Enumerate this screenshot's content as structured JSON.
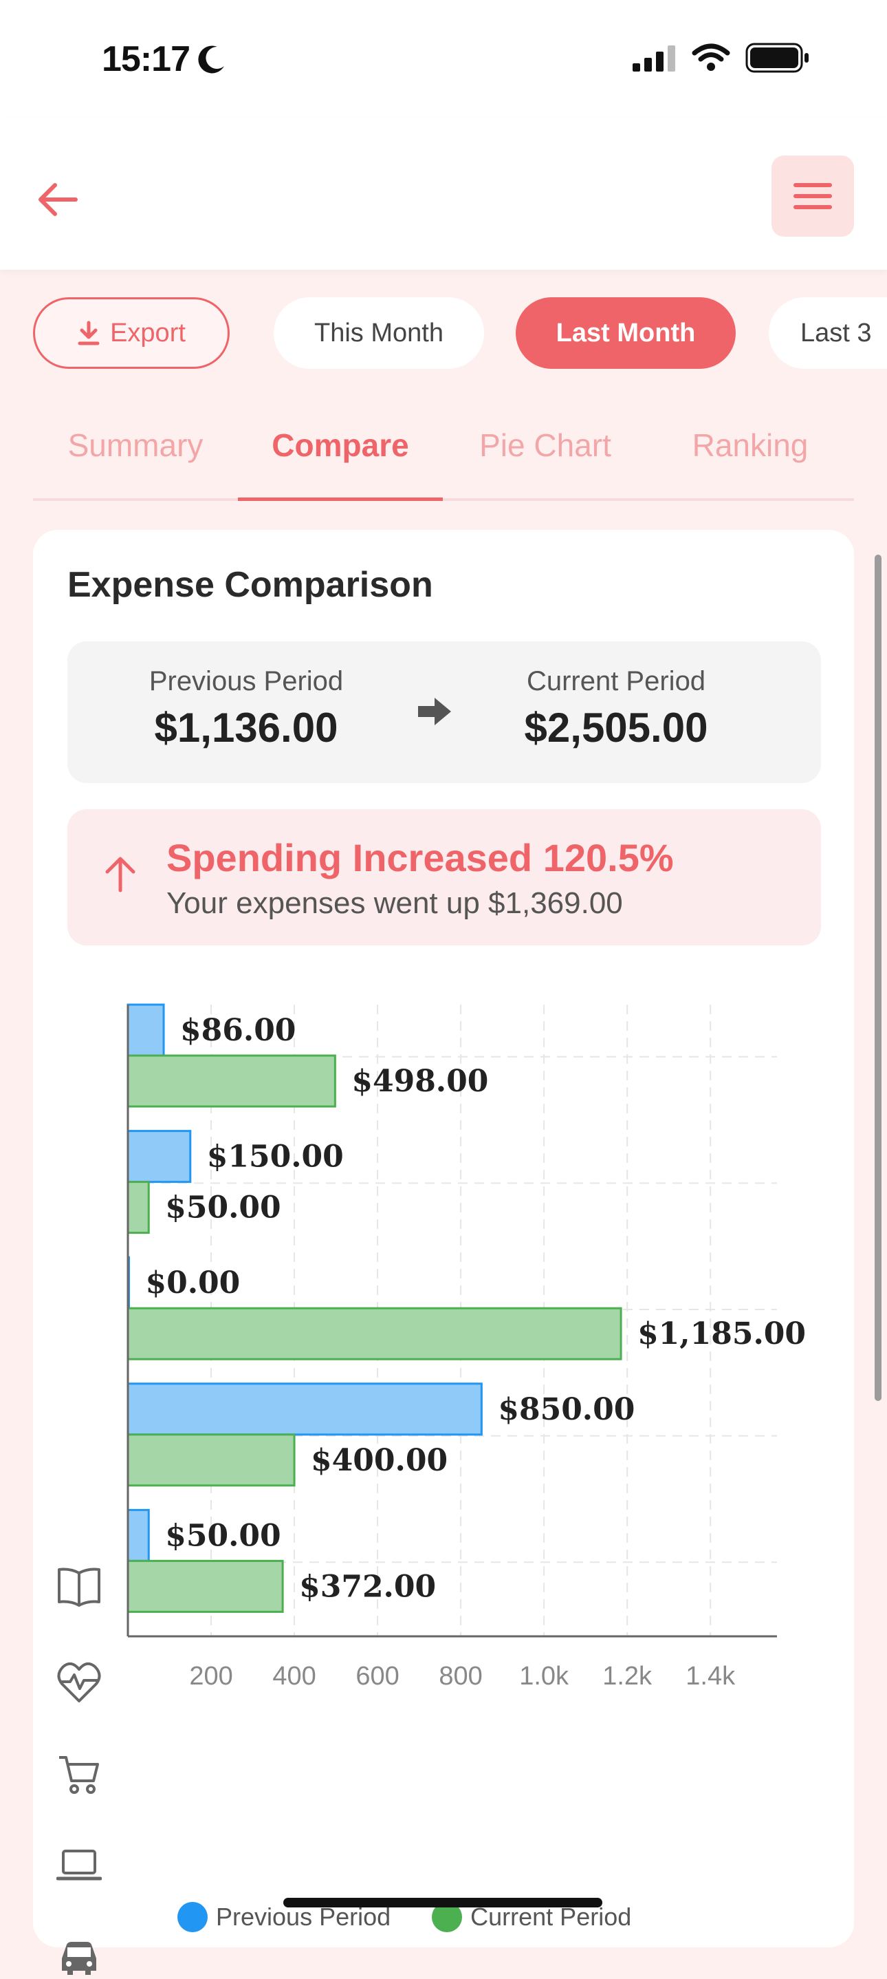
{
  "status": {
    "time": "15:17"
  },
  "toolbar": {
    "back_label": "Back",
    "menu_label": "Menu"
  },
  "chips": {
    "export": "Export",
    "this_month": "This Month",
    "last_month": "Last Month",
    "last_3": "Last 3"
  },
  "tabs": [
    "Summary",
    "Compare",
    "Pie Chart",
    "Ranking"
  ],
  "card": {
    "title": "Expense Comparison",
    "previous_label": "Previous Period",
    "previous_value": "$1,136.00",
    "current_label": "Current Period",
    "current_value": "$2,505.00",
    "alert_title": "Spending Increased 120.5%",
    "alert_subtitle": "Your expenses went up $1,369.00"
  },
  "colors": {
    "accent": "#ef6468",
    "previous": "#2196f3",
    "current": "#4caf50"
  },
  "chart_data": {
    "type": "bar",
    "orientation": "horizontal",
    "categories": [
      "book-icon",
      "health-icon",
      "cart-icon",
      "laptop-icon",
      "car-icon"
    ],
    "series": [
      {
        "name": "Previous Period",
        "values": [
          86,
          150,
          0,
          850,
          50
        ],
        "labels": [
          "$86.00",
          "$150.00",
          "$0.00",
          "$850.00",
          "$50.00"
        ]
      },
      {
        "name": "Current Period",
        "values": [
          498,
          50,
          1185,
          400,
          372
        ],
        "labels": [
          "$498.00",
          "$50.00",
          "$1,185.00",
          "$400.00",
          "$372.00"
        ]
      }
    ],
    "xticks": [
      200,
      400,
      600,
      800,
      1000,
      1200,
      1400
    ],
    "xtick_labels": [
      "200",
      "400",
      "600",
      "800",
      "1.0k",
      "1.2k",
      "1.4k"
    ],
    "xlim": [
      0,
      1560
    ],
    "grid": true,
    "legend": "bottom"
  }
}
